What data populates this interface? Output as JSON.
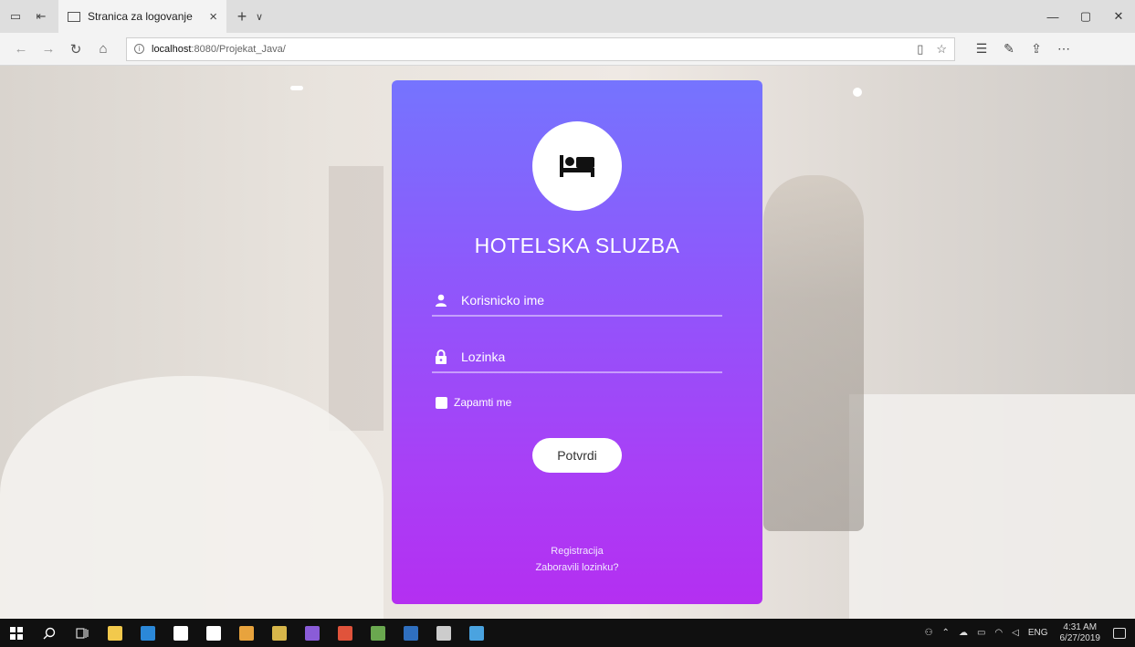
{
  "browser": {
    "tab_title": "Stranica za logovanje",
    "tab_close": "×",
    "new_tab": "+",
    "tab_menu": "∨",
    "url_host": "localhost",
    "url_rest": ":8080/Projekat_Java/",
    "win_minimize": "—",
    "win_restore": "▢",
    "win_close": "✕"
  },
  "login": {
    "title": "HOTELSKA SLUZBA",
    "username_placeholder": "Korisnicko ime",
    "password_placeholder": "Lozinka",
    "remember_label": "Zapamti me",
    "submit_label": "Potvrdi",
    "register_link": "Registracija",
    "forgot_link": "Zaboravili lozinku?"
  },
  "taskbar": {
    "lang": "ENG",
    "time": "4:31 AM",
    "date": "6/27/2019",
    "apps": [
      {
        "name": "file-explorer-icon",
        "color": "#f2c94c"
      },
      {
        "name": "edge-icon",
        "color": "#2b88d8"
      },
      {
        "name": "store-icon",
        "color": "#ffffff"
      },
      {
        "name": "mail-icon",
        "color": "#ffffff"
      },
      {
        "name": "chrome-icon",
        "color": "#e8a33d"
      },
      {
        "name": "app-icon",
        "color": "#d7b64a"
      },
      {
        "name": "visual-studio-icon",
        "color": "#8a5cd8"
      },
      {
        "name": "codeblocks-icon",
        "color": "#e0533b"
      },
      {
        "name": "app2-icon",
        "color": "#6aa84f"
      },
      {
        "name": "vs-code-icon",
        "color": "#2f6fbf"
      },
      {
        "name": "terminal-icon",
        "color": "#cccccc"
      },
      {
        "name": "cube-icon",
        "color": "#4aa3e0"
      }
    ]
  },
  "colors": {
    "card_top": "#7574fe",
    "card_bottom": "#b42ff1",
    "taskbar": "#101010"
  }
}
